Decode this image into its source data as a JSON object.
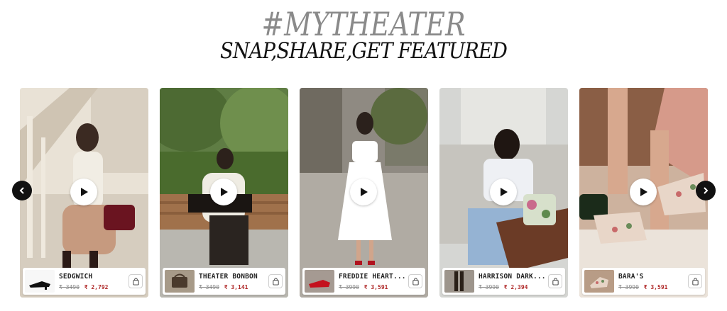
{
  "header": {
    "hashtag": "#MYTHEATER",
    "tagline": "SNAP,SHARE,GET FEATURED"
  },
  "colors": {
    "price_sale": "#b02a2a",
    "price_old": "#888888",
    "arrow_bg": "#111111"
  },
  "icons": {
    "prev": "chevron-left-icon",
    "next": "chevron-right-icon",
    "play": "play-icon",
    "bag": "shopping-bag-icon"
  },
  "cards": [
    {
      "product": "SEDGWICH",
      "old_price": "₹ 3490",
      "price": "₹ 2,792"
    },
    {
      "product": "THEATER BONBON",
      "old_price": "₹ 3490",
      "price": "₹ 3,141"
    },
    {
      "product": "FREDDIE HEART...",
      "old_price": "₹ 3990",
      "price": "₹ 3,591"
    },
    {
      "product": "HARRISON DARK...",
      "old_price": "₹ 3990",
      "price": "₹ 2,394"
    },
    {
      "product": "BARA'S",
      "old_price": "₹ 3990",
      "price": "₹ 3,591"
    }
  ]
}
